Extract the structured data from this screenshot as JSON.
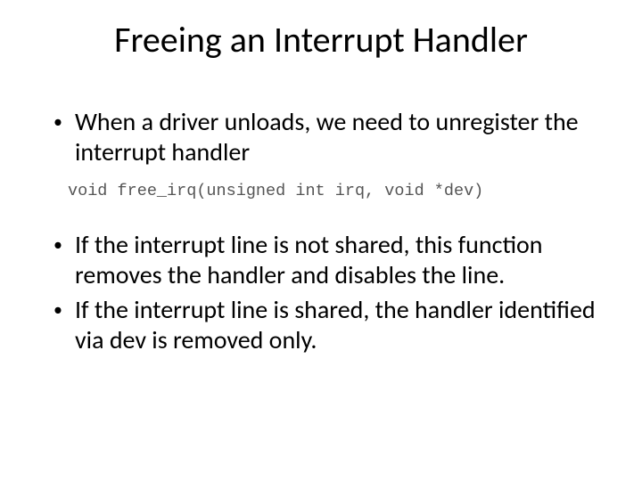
{
  "title": "Freeing an Interrupt Handler",
  "bullets_top": [
    "When a driver unloads, we need to unregister the interrupt handler"
  ],
  "code_line": "void free_irq(unsigned int irq, void *dev)",
  "bullets_bottom": [
    "If the interrupt line is not shared, this function removes the handler and disables the line.",
    "If the interrupt line is shared, the handler identified via dev  is removed only."
  ],
  "bullet_char": "•"
}
